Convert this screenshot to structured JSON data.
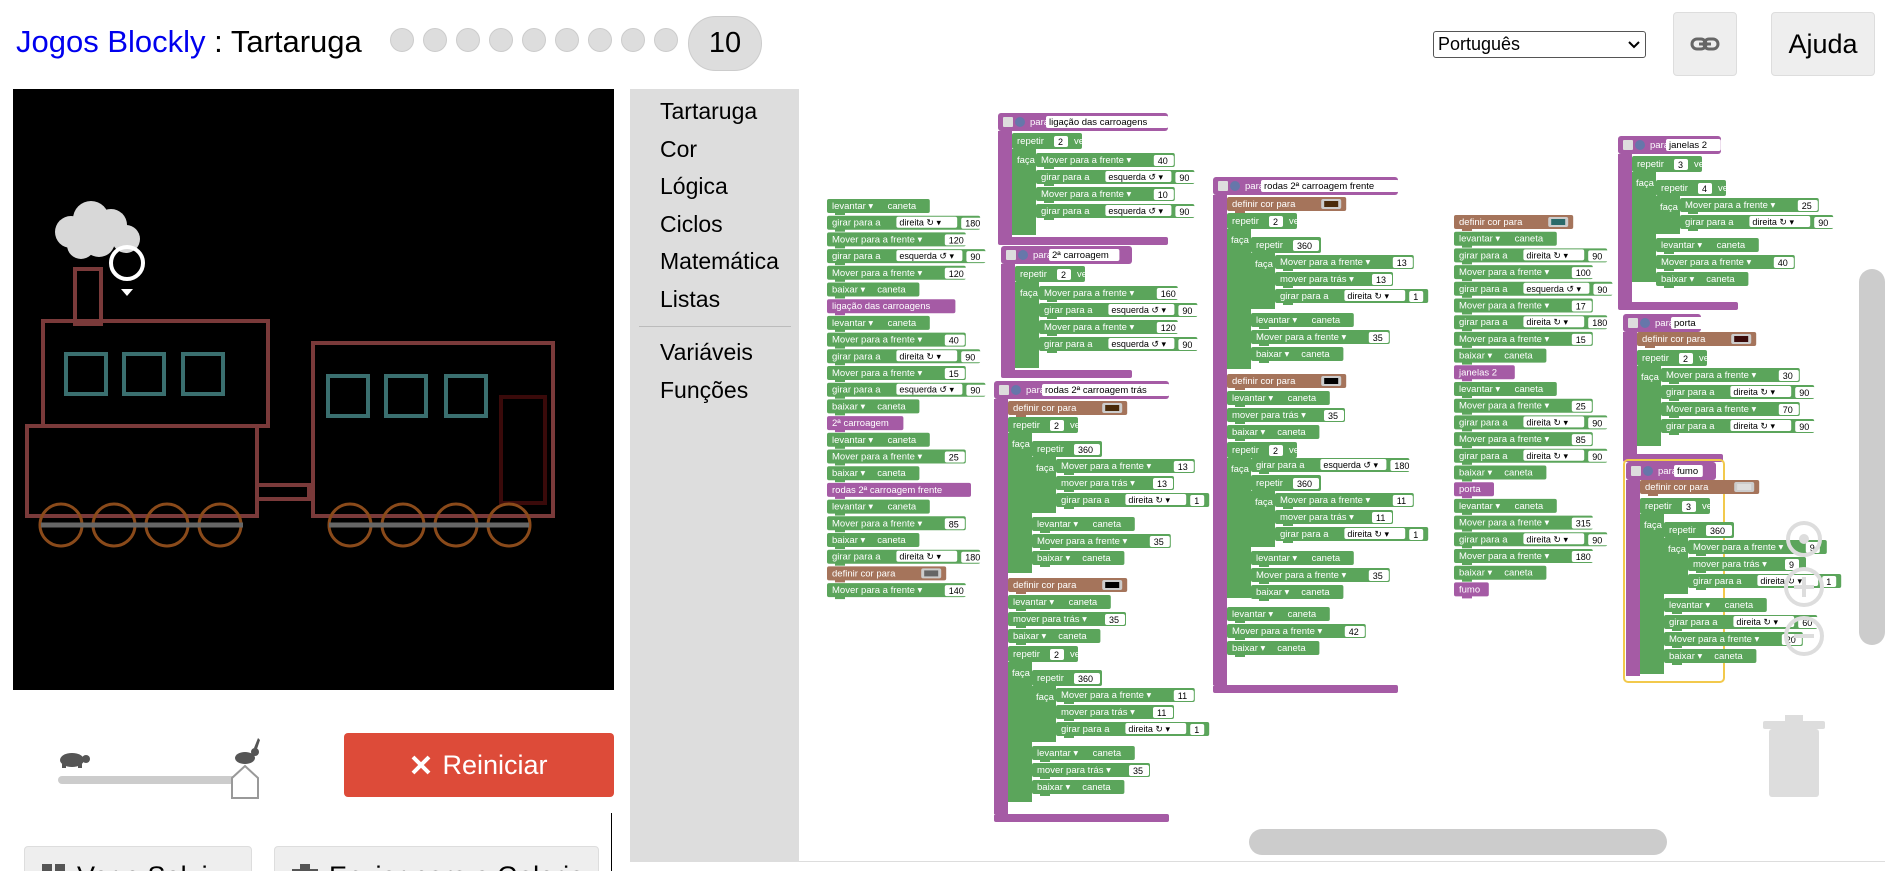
{
  "header": {
    "games_label": "Jogos Blockly",
    "separator": " : ",
    "app_title": "Tartaruga",
    "current_level": "10",
    "level_dots": 9,
    "language": "Português",
    "help_label": "Ajuda"
  },
  "controls": {
    "reset_label": "Reiniciar",
    "bottom_left_label": "Ver o Solui",
    "bottom_right_label": "Enviar para a Galeria"
  },
  "toolbox": {
    "items": [
      "Tartaruga",
      "Cor",
      "Lógica",
      "Ciclos",
      "Matemática",
      "Listas"
    ],
    "items2": [
      "Variáveis",
      "Funções"
    ]
  },
  "blocks": {
    "main": [
      {
        "kind": "pen",
        "text": "levantar",
        "arg": "caneta"
      },
      {
        "kind": "turn",
        "text": "girar para a",
        "dir": "direita ↻",
        "val": "180"
      },
      {
        "kind": "move",
        "text": "Mover para a frente",
        "val": "120"
      },
      {
        "kind": "turn",
        "text": "girar para a",
        "dir": "esquerda ↺",
        "val": "90"
      },
      {
        "kind": "move",
        "text": "Mover para a frente",
        "val": "120"
      },
      {
        "kind": "pen",
        "text": "baixar",
        "arg": "caneta"
      },
      {
        "kind": "call",
        "text": "ligação das carroagens"
      },
      {
        "kind": "pen",
        "text": "levantar",
        "arg": "caneta"
      },
      {
        "kind": "move",
        "text": "Mover para a frente",
        "val": "40"
      },
      {
        "kind": "turn",
        "text": "girar para a",
        "dir": "direita ↻",
        "val": "90"
      },
      {
        "kind": "move",
        "text": "Mover para a frente",
        "val": "15"
      },
      {
        "kind": "turn",
        "text": "girar para a",
        "dir": "esquerda ↺",
        "val": "90"
      },
      {
        "kind": "pen",
        "text": "baixar",
        "arg": "caneta"
      },
      {
        "kind": "call",
        "text": "2ª carroagem"
      },
      {
        "kind": "pen",
        "text": "levantar",
        "arg": "caneta"
      },
      {
        "kind": "move",
        "text": "Mover para a frente",
        "val": "25"
      },
      {
        "kind": "pen",
        "text": "baixar",
        "arg": "caneta"
      },
      {
        "kind": "call",
        "text": "rodas 2ª carroagem frente"
      },
      {
        "kind": "pen",
        "text": "levantar",
        "arg": "caneta"
      },
      {
        "kind": "move",
        "text": "Mover para a frente",
        "val": "85"
      },
      {
        "kind": "pen",
        "text": "baixar",
        "arg": "caneta"
      },
      {
        "kind": "turn",
        "text": "girar para a",
        "dir": "direita ↻",
        "val": "180"
      },
      {
        "kind": "color",
        "text": "definir cor para",
        "swatch": "#666666"
      },
      {
        "kind": "move",
        "text": "Mover para a frente",
        "val": "140"
      }
    ],
    "col2_functions": [
      {
        "name": "ligação das carroagens",
        "repeat": "2",
        "body": [
          {
            "kind": "move",
            "text": "Mover para a frente",
            "val": "40"
          },
          {
            "kind": "turn",
            "text": "girar para a",
            "dir": "esquerda ↺",
            "val": "90"
          },
          {
            "kind": "move",
            "text": "Mover para a frente",
            "val": "10"
          },
          {
            "kind": "turn",
            "text": "girar para a",
            "dir": "esquerda ↺",
            "val": "90"
          }
        ]
      },
      {
        "name": "2ª carroagem",
        "repeat": "2",
        "body": [
          {
            "kind": "move",
            "text": "Mover para a frente",
            "val": "160"
          },
          {
            "kind": "turn",
            "text": "girar para a",
            "dir": "esquerda ↺",
            "val": "90"
          },
          {
            "kind": "move",
            "text": "Mover para a frente",
            "val": "120"
          },
          {
            "kind": "turn",
            "text": "girar para a",
            "dir": "esquerda ↺",
            "val": "90"
          }
        ]
      }
    ],
    "rear_wheels": {
      "name": "rodas 2ª carroagem trás",
      "color_label": "definir cor para",
      "repeat_label": "repetir",
      "times_label": "vez",
      "do_label": "faça",
      "items": [
        {
          "kind": "move",
          "text": "Mover para a frente",
          "val": "13"
        },
        {
          "kind": "moveback",
          "text": "mover para trás",
          "val": "13"
        },
        {
          "kind": "turn",
          "text": "girar para a",
          "dir": "direita ↻",
          "val": "1"
        },
        {
          "kind": "pen",
          "text": "levantar",
          "arg": "caneta"
        },
        {
          "kind": "move",
          "text": "Mover para a frente",
          "val": "35"
        },
        {
          "kind": "pen",
          "text": "baixar",
          "arg": "caneta"
        },
        {
          "kind": "pen",
          "text": "levantar",
          "arg": "caneta"
        },
        {
          "kind": "moveback",
          "text": "mover para trás",
          "val": "35"
        },
        {
          "kind": "pen",
          "text": "baixar",
          "arg": "caneta"
        },
        {
          "kind": "move",
          "text": "Mover para a frente",
          "val": "11"
        },
        {
          "kind": "moveback",
          "text": "mover para trás",
          "val": "11"
        },
        {
          "kind": "turn",
          "text": "girar para a",
          "dir": "direita ↻",
          "val": "1"
        },
        {
          "kind": "pen",
          "text": "levantar",
          "arg": "caneta"
        },
        {
          "kind": "moveback",
          "text": "mover para trás",
          "val": "35"
        },
        {
          "kind": "pen",
          "text": "baixar",
          "arg": "caneta"
        }
      ],
      "repeat_vals": [
        "2",
        "360",
        "2",
        "360"
      ]
    },
    "front_wheels": {
      "name": "rodas 2ª carroagem frente",
      "items": [
        {
          "kind": "move",
          "text": "Mover para a frente",
          "val": "13"
        },
        {
          "kind": "moveback",
          "text": "mover para trás",
          "val": "13"
        },
        {
          "kind": "turn",
          "text": "girar para a",
          "dir": "direita ↻",
          "val": "1"
        },
        {
          "kind": "pen",
          "text": "levantar",
          "arg": "caneta"
        },
        {
          "kind": "move",
          "text": "Mover para a frente",
          "val": "35"
        },
        {
          "kind": "pen",
          "text": "baixar",
          "arg": "caneta"
        },
        {
          "kind": "pen",
          "text": "levantar",
          "arg": "caneta"
        },
        {
          "kind": "moveback",
          "text": "mover para trás",
          "val": "35"
        },
        {
          "kind": "pen",
          "text": "baixar",
          "arg": "caneta"
        },
        {
          "kind": "turn",
          "text": "girar para a",
          "dir": "esquerda ↺",
          "val": "180"
        },
        {
          "kind": "move",
          "text": "Mover para a frente",
          "val": "11"
        },
        {
          "kind": "moveback",
          "text": "mover para trás",
          "val": "11"
        },
        {
          "kind": "turn",
          "text": "girar para a",
          "dir": "direita ↻",
          "val": "1"
        },
        {
          "kind": "pen",
          "text": "levantar",
          "arg": "caneta"
        },
        {
          "kind": "move",
          "text": "Mover para a frente",
          "val": "35"
        },
        {
          "kind": "pen",
          "text": "baixar",
          "arg": "caneta"
        },
        {
          "kind": "pen",
          "text": "levantar",
          "arg": "caneta"
        },
        {
          "kind": "move",
          "text": "Mover para a frente",
          "val": "42"
        },
        {
          "kind": "pen",
          "text": "baixar",
          "arg": "caneta"
        }
      ],
      "repeat_vals": [
        "2",
        "360",
        "2",
        "360"
      ]
    },
    "col4": [
      {
        "kind": "color",
        "text": "definir cor para",
        "swatch": "#2a6a6a"
      },
      {
        "kind": "pen",
        "text": "levantar",
        "arg": "caneta"
      },
      {
        "kind": "turn",
        "text": "girar para a",
        "dir": "direita ↻",
        "val": "90"
      },
      {
        "kind": "move",
        "text": "Mover para a frente",
        "val": "100"
      },
      {
        "kind": "turn",
        "text": "girar para a",
        "dir": "esquerda ↺",
        "val": "90"
      },
      {
        "kind": "move",
        "text": "Mover para a frente",
        "val": "17"
      },
      {
        "kind": "turn",
        "text": "girar para a",
        "dir": "direita ↻",
        "val": "180"
      },
      {
        "kind": "move",
        "text": "Mover para a frente",
        "val": "15"
      },
      {
        "kind": "pen",
        "text": "baixar",
        "arg": "caneta"
      },
      {
        "kind": "call",
        "text": "janelas 2"
      },
      {
        "kind": "pen",
        "text": "levantar",
        "arg": "caneta"
      },
      {
        "kind": "move",
        "text": "Mover para a frente",
        "val": "25"
      },
      {
        "kind": "turn",
        "text": "girar para a",
        "dir": "direita ↻",
        "val": "90"
      },
      {
        "kind": "move",
        "text": "Mover para a frente",
        "val": "85"
      },
      {
        "kind": "turn",
        "text": "girar para a",
        "dir": "direita ↻",
        "val": "90"
      },
      {
        "kind": "pen",
        "text": "baixar",
        "arg": "caneta"
      },
      {
        "kind": "call",
        "text": "porta"
      },
      {
        "kind": "pen",
        "text": "levantar",
        "arg": "caneta"
      },
      {
        "kind": "move",
        "text": "Mover para a frente",
        "val": "315"
      },
      {
        "kind": "turn",
        "text": "girar para a",
        "dir": "direita ↻",
        "val": "90"
      },
      {
        "kind": "move",
        "text": "Mover para a frente",
        "val": "180"
      },
      {
        "kind": "pen",
        "text": "baixar",
        "arg": "caneta"
      },
      {
        "kind": "call",
        "text": "fumo"
      }
    ],
    "janelas": {
      "name": "janelas 2",
      "repeat1": "3",
      "repeat2": "4",
      "items": [
        {
          "kind": "move",
          "text": "Mover para a frente",
          "val": "25"
        },
        {
          "kind": "turn",
          "text": "girar para a",
          "dir": "direita ↻",
          "val": "90"
        },
        {
          "kind": "pen",
          "text": "levantar",
          "arg": "caneta"
        },
        {
          "kind": "move",
          "text": "Mover para a frente",
          "val": "40"
        },
        {
          "kind": "pen",
          "text": "baixar",
          "arg": "caneta"
        }
      ]
    },
    "porta": {
      "name": "porta",
      "repeat": "2",
      "swatch": "#3a0a0a",
      "items": [
        {
          "kind": "move",
          "text": "Mover para a frente",
          "val": "30"
        },
        {
          "kind": "turn",
          "text": "girar para a",
          "dir": "direita ↻",
          "val": "90"
        },
        {
          "kind": "move",
          "text": "Mover para a frente",
          "val": "70"
        },
        {
          "kind": "turn",
          "text": "girar para a",
          "dir": "direita ↻",
          "val": "90"
        }
      ]
    },
    "fumo": {
      "name": "fumo",
      "repeat1": "3",
      "repeat2": "360",
      "swatch": "#dddddd",
      "items": [
        {
          "kind": "move",
          "text": "Mover para a frente",
          "val": "9"
        },
        {
          "kind": "moveback",
          "text": "mover para trás",
          "val": "9"
        },
        {
          "kind": "turn",
          "text": "girar para a",
          "dir": "direita ↻",
          "val": "1"
        },
        {
          "kind": "pen",
          "text": "levantar",
          "arg": "caneta"
        },
        {
          "kind": "turn",
          "text": "girar para a",
          "dir": "direita ↻",
          "val": "60"
        },
        {
          "kind": "move",
          "text": "Mover para a frente",
          "val": "20"
        },
        {
          "kind": "pen",
          "text": "baixar",
          "arg": "caneta"
        }
      ]
    },
    "labels": {
      "to": "para",
      "repeat": "repetir",
      "times": "vez",
      "do": "faça",
      "color": "definir cor para"
    }
  },
  "colors": {
    "turtle_green": "#5ba55b",
    "procedure_purple": "#a55ba5",
    "color_brown": "#a5745b",
    "reset_red": "#dd4b39",
    "train_red": "#7a3a3a",
    "window_teal": "#3a6f6f",
    "wheel_orange": "#8a4a1a"
  }
}
